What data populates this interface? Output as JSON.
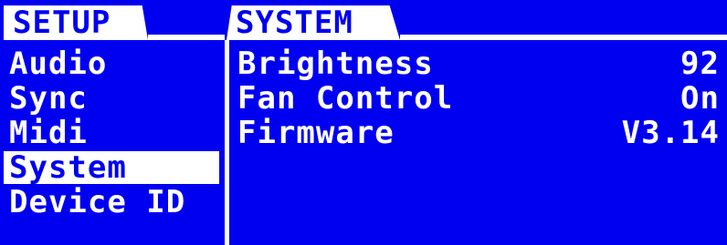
{
  "tabs": {
    "left": "SETUP",
    "right": "SYSTEM"
  },
  "menu": {
    "items": [
      {
        "label": "Audio"
      },
      {
        "label": "Sync"
      },
      {
        "label": "Midi"
      },
      {
        "label": "System",
        "selected": true
      },
      {
        "label": "Device ID"
      }
    ]
  },
  "params": [
    {
      "name": "Brightness",
      "value": "92"
    },
    {
      "name": "Fan Control",
      "value": "On"
    },
    {
      "name": "Firmware",
      "value": "V3.14"
    }
  ],
  "colors": {
    "background": "#0000f0",
    "foreground": "#ffffff"
  }
}
